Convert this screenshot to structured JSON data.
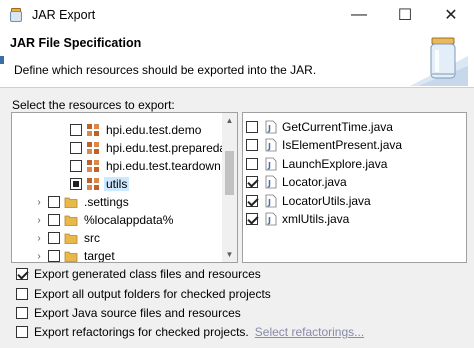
{
  "window": {
    "title": "JAR Export",
    "minimize_glyph": "—",
    "maximize_glyph": "☐",
    "close_glyph": "✕"
  },
  "header": {
    "title": "JAR File Specification",
    "description": "Define which resources should be exported into the JAR."
  },
  "resources_label": "Select the resources to export:",
  "tree": [
    {
      "label": "hpi.edu.test.demo",
      "icon": "package-icon",
      "state": "unchecked",
      "twisty": ""
    },
    {
      "label": "hpi.edu.test.preparedata",
      "icon": "package-icon",
      "state": "unchecked",
      "twisty": ""
    },
    {
      "label": "hpi.edu.test.teardown",
      "icon": "package-icon",
      "state": "unchecked",
      "twisty": ""
    },
    {
      "label": "utils",
      "icon": "package-icon",
      "state": "partial",
      "twisty": "",
      "selected": true
    },
    {
      "label": ".settings",
      "icon": "folder-icon",
      "state": "unchecked",
      "twisty": "›"
    },
    {
      "label": "%localappdata%",
      "icon": "folder-icon",
      "state": "unchecked",
      "twisty": "›"
    },
    {
      "label": "src",
      "icon": "folder-icon",
      "state": "unchecked",
      "twisty": "›"
    },
    {
      "label": "target",
      "icon": "folder-icon",
      "state": "unchecked",
      "twisty": "›"
    }
  ],
  "files": [
    {
      "label": "GetCurrentTime.java",
      "checked": false
    },
    {
      "label": "IsElementPresent.java",
      "checked": false
    },
    {
      "label": "LaunchExplore.java",
      "checked": false
    },
    {
      "label": "Locator.java",
      "checked": true
    },
    {
      "label": "LocatorUtils.java",
      "checked": true
    },
    {
      "label": "xmlUtils.java",
      "checked": true
    }
  ],
  "options": [
    {
      "label": "Export generated class files and resources",
      "checked": true
    },
    {
      "label": "Export all output folders for checked projects",
      "checked": false
    },
    {
      "label": "Export Java source files and resources",
      "checked": false
    },
    {
      "label": "Export refactorings for checked projects.",
      "checked": false,
      "link": "Select refactorings..."
    }
  ],
  "colors": {
    "selection": "#cde8ff",
    "package": "#c0612b",
    "folder": "#e8b84a",
    "link": "#8a8aa8"
  }
}
